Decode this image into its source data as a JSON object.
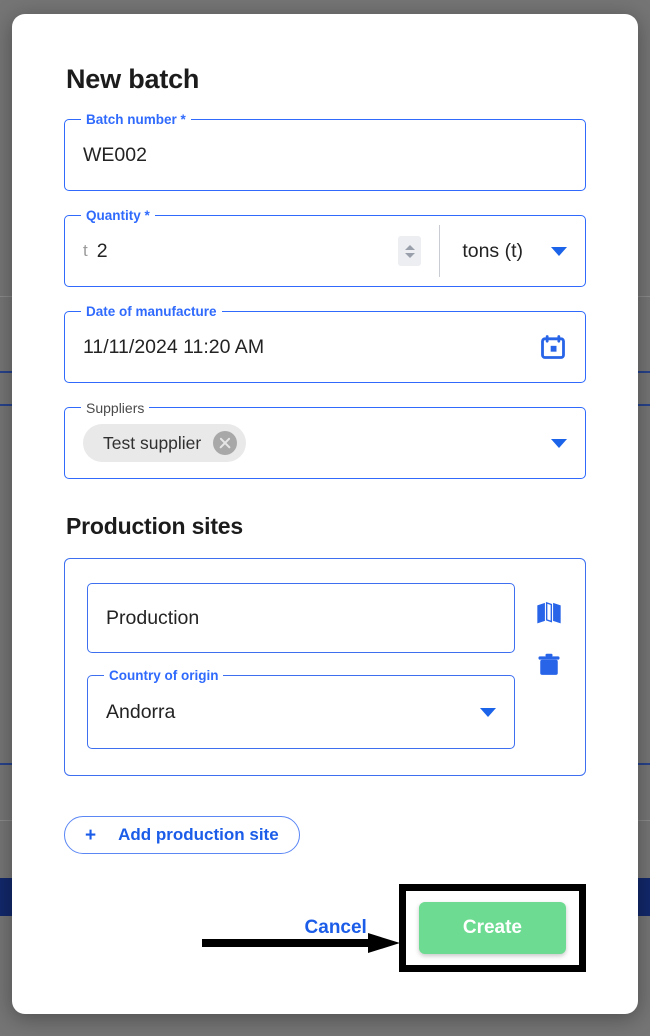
{
  "dialog": {
    "title": "New batch",
    "fields": {
      "batch_number": {
        "label": "Batch number *",
        "value": "WE002"
      },
      "quantity": {
        "label": "Quantity *",
        "prefix": "t",
        "value": "2",
        "unit_value": "tons (t)",
        "spinner_icon": "number-spinner-icon",
        "dropdown_icon": "chevron-down-icon"
      },
      "date_of_manufacture": {
        "label": "Date of manufacture",
        "value": "11/11/2024 11:20 AM",
        "icon": "calendar-icon"
      },
      "suppliers": {
        "label": "Suppliers",
        "chips": [
          {
            "label": "Test supplier",
            "remove_icon": "close-circle-icon"
          }
        ],
        "dropdown_icon": "chevron-down-icon"
      }
    },
    "production_sites": {
      "title": "Production sites",
      "site": {
        "name_value": "Production",
        "country_label": "Country of origin",
        "country_value": "Andorra",
        "map_icon": "map-icon",
        "delete_icon": "trash-icon",
        "dropdown_icon": "chevron-down-icon"
      },
      "add_button": {
        "plus": "+",
        "label": "Add production site"
      }
    },
    "footer": {
      "cancel_label": "Cancel",
      "create_label": "Create"
    }
  },
  "annotation": {
    "arrow_icon": "right-arrow-annotation",
    "highlight_target": "create-button"
  },
  "colors": {
    "accent_blue": "#2f6afc",
    "link_blue": "#1b5ce8",
    "create_green": "#6ddb91",
    "chip_grey": "#e9e9ea",
    "backdrop_grey": "#757575",
    "band_navy": "#12286b"
  }
}
